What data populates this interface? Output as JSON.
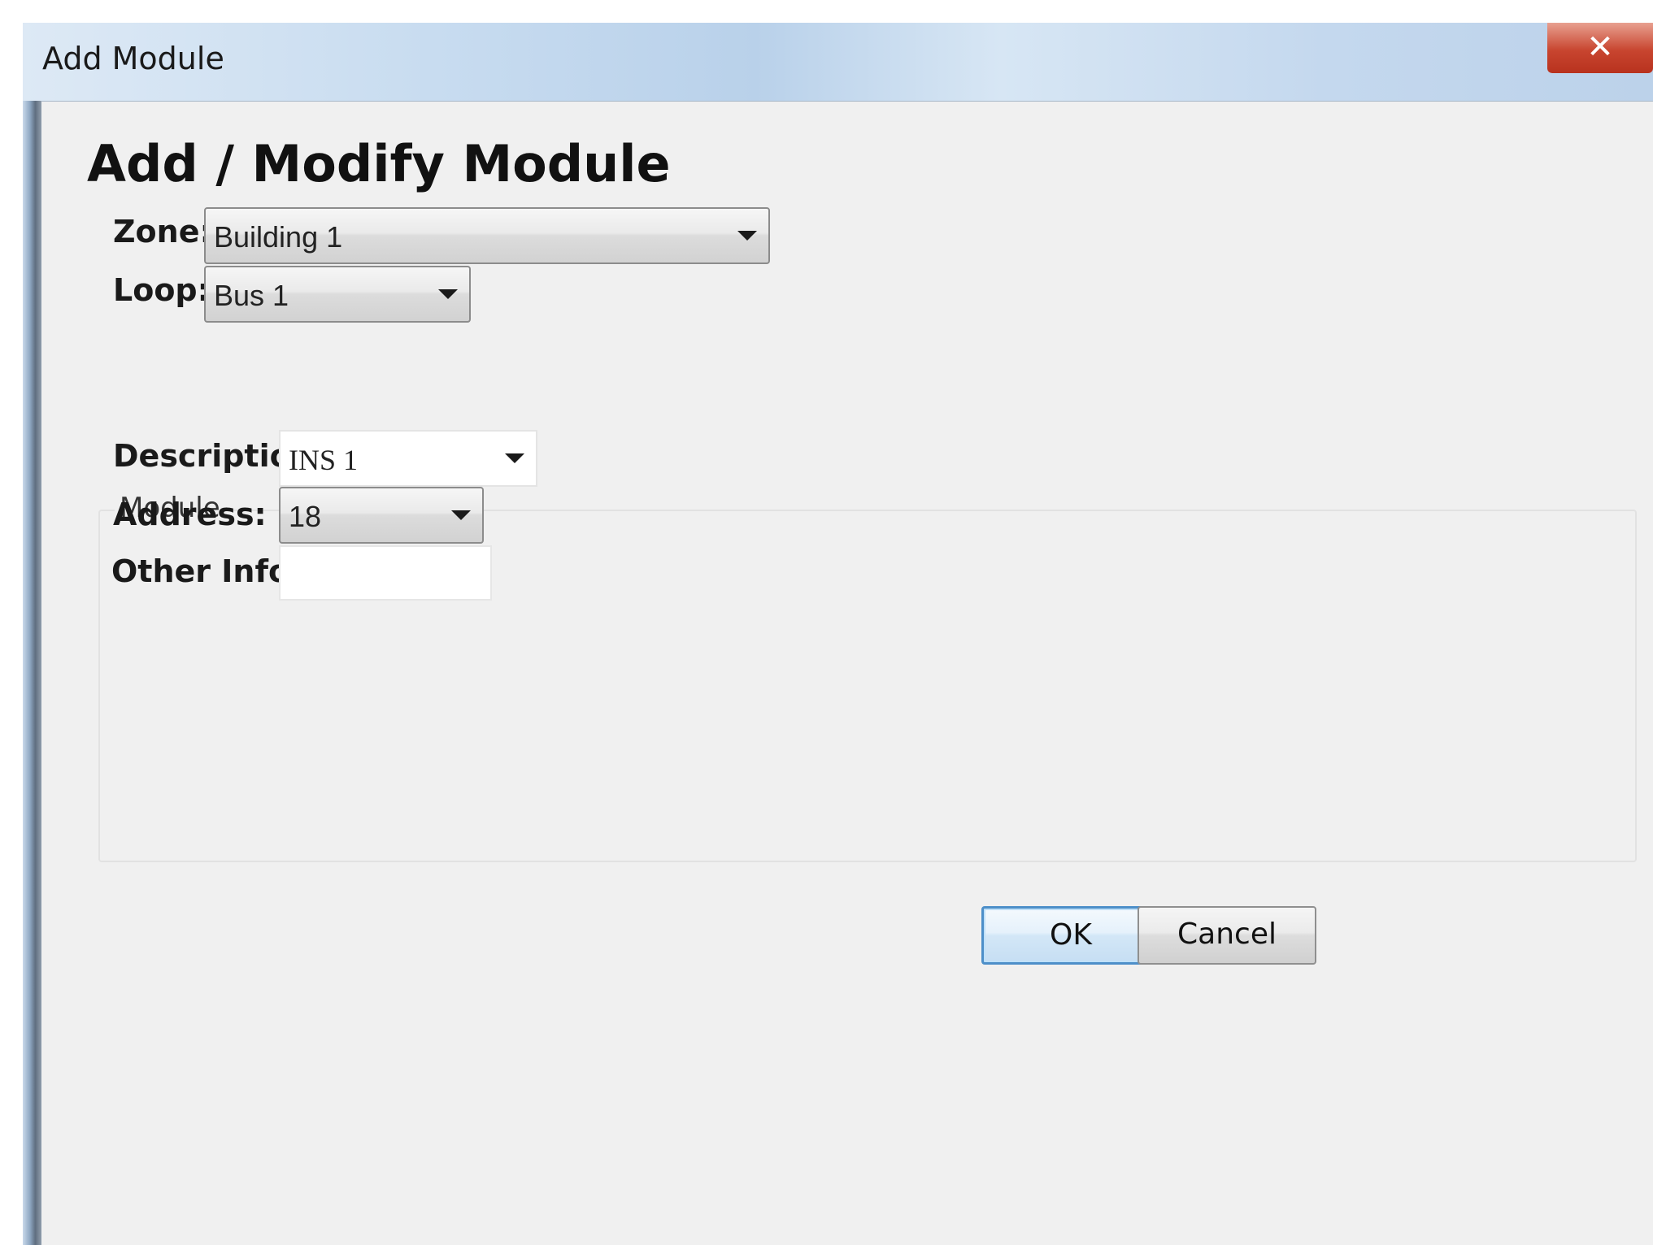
{
  "window": {
    "title": "Add Module",
    "close_glyph": "✕"
  },
  "form": {
    "heading": "Add / Modify Module",
    "zone": {
      "label": "Zone:",
      "value": "Building 1"
    },
    "loop": {
      "label": "Loop:",
      "value": "Bus 1"
    }
  },
  "module_group": {
    "title": "Module",
    "description": {
      "label": "Description:",
      "value": "INS 1"
    },
    "address": {
      "label": "Address:",
      "value": "18"
    },
    "other_info": {
      "label": "Other Info:",
      "value": ""
    }
  },
  "buttons": {
    "ok": "OK",
    "cancel": "Cancel"
  },
  "icons": {
    "close": "close-icon",
    "dropdown": "chevron-down-icon"
  },
  "colors": {
    "close_button": "#c8452f",
    "ok_border": "#4d8fc9",
    "dialog_bg": "#f0f0f0"
  }
}
